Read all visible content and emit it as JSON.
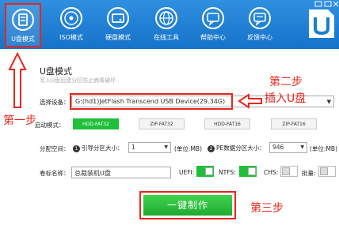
{
  "nav": [
    {
      "label": "U盘模式",
      "icon": "usb-drive-icon"
    },
    {
      "label": "ISO模式",
      "icon": "disc-icon"
    },
    {
      "label": "硬盘模式",
      "icon": "hard-disk-icon"
    },
    {
      "label": "在线工具",
      "icon": "globe-icon"
    },
    {
      "label": "帮助中心",
      "icon": "help-icon"
    },
    {
      "label": "反馈中心",
      "icon": "feedback-icon"
    }
  ],
  "page": {
    "title": "U盘模式",
    "subtitle": "写入U盘后建分区防止病毒破坏"
  },
  "form": {
    "device_label": "选择设备：",
    "device_value": "G:(hd1)JetFlash Transcend USB Device(29.34G)",
    "mode_label": "启动模式：",
    "modes": [
      "HDD-FAT32",
      "ZIP-FAT32",
      "HDD-FAT16",
      "ZIP-FAT16"
    ],
    "alloc_label": "分配空间：",
    "boot_num": "1",
    "boot_label": "引导分区大小：",
    "boot_value": "1",
    "unit1": "(单位:MB)",
    "pe_num": "2",
    "pe_label": "PE数据分区大小：",
    "pe_value": "946",
    "unit2": "(单位:MB)",
    "volume_label": "卷标名称：",
    "volume_value": "总裁装机U盘",
    "uefi_label": "UEFI:",
    "ntfs_label": "NTFS:",
    "chs_label": "CHS:",
    "batch_label": "批量:",
    "make_button": "一键制作"
  },
  "annotations": {
    "step1": "第一步",
    "step2": "第二步",
    "step2b": "插入U盘",
    "step3": "第三步"
  },
  "colors": {
    "topbar": "#1a7dd4",
    "accent_green": "#1fbf3a",
    "annotation_red": "#e8261c"
  }
}
